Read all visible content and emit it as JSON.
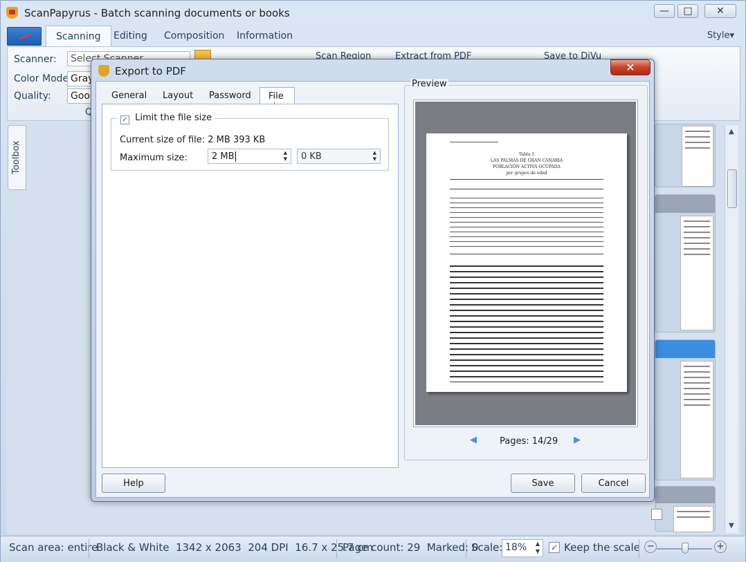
{
  "window": {
    "title": "ScanPapyrus - Batch scanning documents or books",
    "minimize_glyph": "—",
    "maximize_glyph": "□",
    "close_glyph": "✕"
  },
  "ribbon": {
    "tabs": [
      "Scanning",
      "Editing",
      "Composition",
      "Information"
    ],
    "active_tab": "Scanning",
    "style_menu": "Style▾",
    "scanner_label": "Scanner:",
    "scanner_value": "Select Scanner",
    "color_mode_label": "Color Mode:",
    "color_mode_value": "Grays",
    "quality_label": "Quality:",
    "quality_value": "Good",
    "section_label": "Q",
    "tools": {
      "scan_region": "Scan Region",
      "extract_pdf": "Extract from PDF",
      "save_djvu": "Save to DjVu"
    }
  },
  "toolbox": {
    "label": "Toolbox"
  },
  "status": {
    "scan_area": "Scan area: entire",
    "image_info": "Black & White  1342 x 2063  204 DPI  16.7 x 25.7 cm",
    "page_count": "Page count: 29  Marked: 0",
    "scale_label": "Scale:",
    "scale_value": "18%",
    "keep_scale": "Keep the scale",
    "keep_scale_checked": true,
    "zoom_minus": "−",
    "zoom_plus": "+"
  },
  "dialog": {
    "title": "Export to PDF",
    "close_glyph": "✕",
    "tabs": [
      "General",
      "Layout",
      "Password",
      "File size"
    ],
    "active_tab": "File size",
    "limit_label": "Limit the file size",
    "limit_checked": true,
    "current_size_label": "Current size of file: 2 MB 393 KB",
    "max_size_label": "Maximum size:",
    "max_mb": "2 MB",
    "max_kb": "0 KB",
    "preview_title": "Preview",
    "pages": "Pages: 14/29",
    "buttons": {
      "help": "Help",
      "save": "Save",
      "cancel": "Cancel"
    },
    "preview_page": {
      "header": "Tabla 1",
      "title": "LAS PALMAS DE GRAN CANARIA",
      "subtitle1": "POBLACIÓN ACTIVA OCUPADA",
      "subtitle2": "por grupos de edad"
    }
  },
  "colors": {
    "accent": "#1e5bb0",
    "dialog_close": "#c7412b",
    "selection": "#3b8de0"
  }
}
